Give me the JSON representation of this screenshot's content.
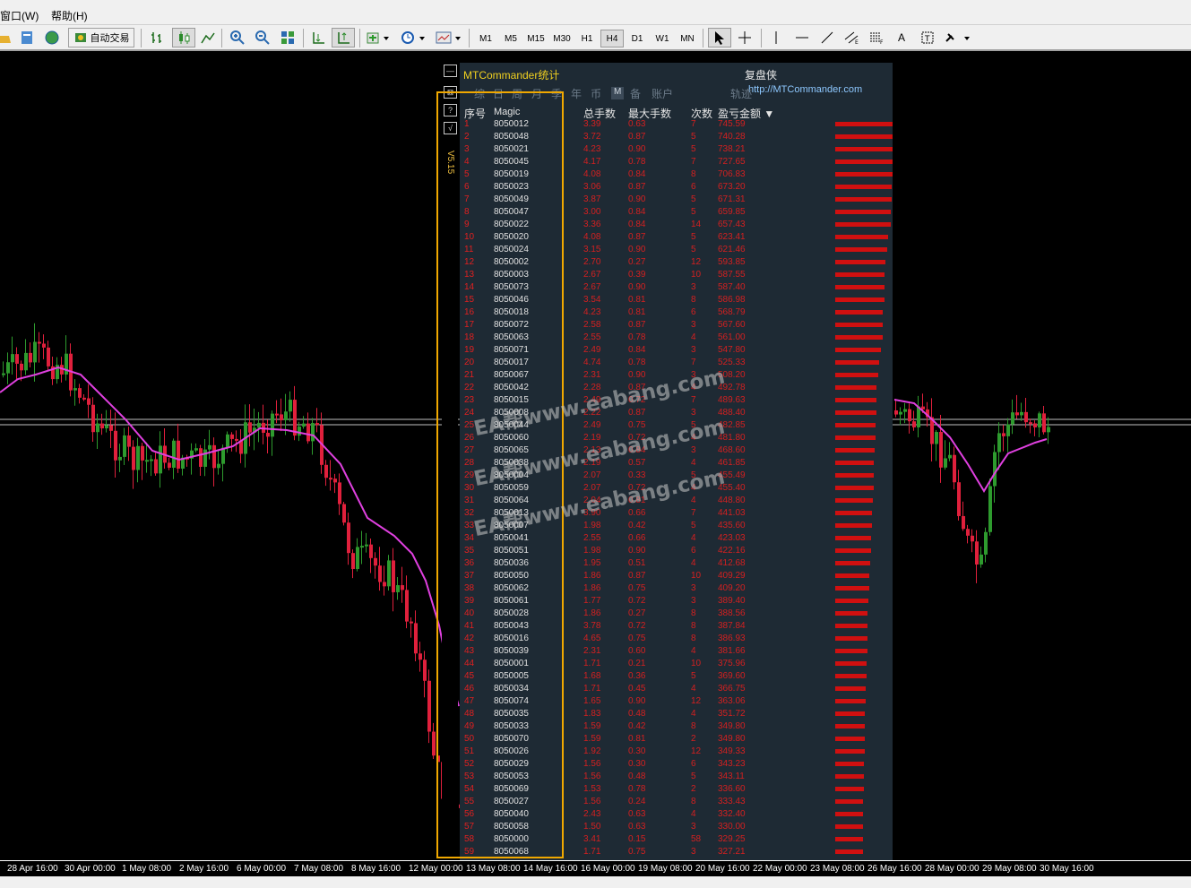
{
  "menu": {
    "window": "窗口(W)",
    "help": "帮助(H)"
  },
  "toolbar": {
    "auto_trade_label": "自动交易",
    "timeframes": [
      "M1",
      "M5",
      "M15",
      "M30",
      "H1",
      "H4",
      "D1",
      "W1",
      "MN"
    ],
    "active_timeframe": "H4",
    "text_tool_label": "A"
  },
  "chart": {
    "time_axis_labels": [
      "28 Apr 16:00",
      "30 Apr 00:00",
      "1 May 08:00",
      "2 May 16:00",
      "6 May 00:00",
      "7 May 08:00",
      "8 May 16:00",
      "12 May 00:00",
      "13 May 08:00",
      "14 May 16:00",
      "16 May 00:00",
      "19 May 08:00",
      "20 May 16:00",
      "22 May 00:00",
      "23 May 08:00",
      "26 May 16:00",
      "28 May 00:00",
      "29 May 08:00",
      "30 May 16:00"
    ],
    "colors": {
      "bull": "#2e9b2e",
      "bear": "#e0203c",
      "ma": "#e040e0",
      "price_line": "#c0c0c0"
    }
  },
  "panel": {
    "title": "MTCommander统计",
    "brand_name": "复盘侠",
    "brand_url": "http://MTCommander.com",
    "version": "V5.15",
    "side_buttons": [
      "—",
      "⊠",
      "?",
      "√"
    ],
    "tabs": [
      "综",
      "日",
      "周",
      "月",
      "季",
      "年",
      "币",
      "M",
      "备",
      "账户",
      "轨迹"
    ],
    "selected_tab": "M",
    "headers": {
      "idx": "序号",
      "magic": "Magic",
      "total_lots": "总手数",
      "max_lots": "最大手数",
      "count": "次数",
      "pnl": "盈亏金额 ▼"
    },
    "rows": [
      [
        "1",
        "8050012",
        "3.39",
        "0.63",
        "7",
        "745.59"
      ],
      [
        "2",
        "8050048",
        "3.72",
        "0.87",
        "5",
        "740.28"
      ],
      [
        "3",
        "8050021",
        "4.23",
        "0.90",
        "5",
        "738.21"
      ],
      [
        "4",
        "8050045",
        "4.17",
        "0.78",
        "7",
        "727.65"
      ],
      [
        "5",
        "8050019",
        "4.08",
        "0.84",
        "8",
        "706.83"
      ],
      [
        "6",
        "8050023",
        "3.06",
        "0.87",
        "6",
        "673.20"
      ],
      [
        "7",
        "8050049",
        "3.87",
        "0.90",
        "5",
        "671.31"
      ],
      [
        "8",
        "8050047",
        "3.00",
        "0.84",
        "5",
        "659.85"
      ],
      [
        "9",
        "8050022",
        "3.36",
        "0.84",
        "14",
        "657.43"
      ],
      [
        "10",
        "8050020",
        "4.08",
        "0.87",
        "5",
        "623.41"
      ],
      [
        "11",
        "8050024",
        "3.15",
        "0.90",
        "5",
        "621.46"
      ],
      [
        "12",
        "8050002",
        "2.70",
        "0.27",
        "12",
        "593.85"
      ],
      [
        "13",
        "8050003",
        "2.67",
        "0.39",
        "10",
        "587.55"
      ],
      [
        "14",
        "8050073",
        "2.67",
        "0.90",
        "3",
        "587.40"
      ],
      [
        "15",
        "8050046",
        "3.54",
        "0.81",
        "8",
        "586.98"
      ],
      [
        "16",
        "8050018",
        "4.23",
        "0.81",
        "6",
        "568.79"
      ],
      [
        "17",
        "8050072",
        "2.58",
        "0.87",
        "3",
        "567.60"
      ],
      [
        "18",
        "8050063",
        "2.55",
        "0.78",
        "4",
        "561.00"
      ],
      [
        "19",
        "8050071",
        "2.49",
        "0.84",
        "3",
        "547.80"
      ],
      [
        "20",
        "8050017",
        "4.74",
        "0.78",
        "7",
        "525.33"
      ],
      [
        "21",
        "8050067",
        "2.31",
        "0.90",
        "3",
        "508.20"
      ],
      [
        "22",
        "8050042",
        "2.28",
        "0.87",
        "4",
        "492.78"
      ],
      [
        "23",
        "8050015",
        "2.49",
        "0.72",
        "7",
        "489.63"
      ],
      [
        "24",
        "8050008",
        "2.22",
        "0.87",
        "3",
        "488.40"
      ],
      [
        "25",
        "8050044",
        "2.49",
        "0.75",
        "5",
        "482.85"
      ],
      [
        "26",
        "8050060",
        "2.19",
        "0.72",
        "4",
        "481.80"
      ],
      [
        "27",
        "8050065",
        "2.13",
        "0.84",
        "3",
        "468.60"
      ],
      [
        "28",
        "8050038",
        "2.19",
        "0.57",
        "4",
        "461.85"
      ],
      [
        "29",
        "8050004",
        "2.07",
        "0.33",
        "5",
        "455.49"
      ],
      [
        "30",
        "8050059",
        "2.07",
        "0.72",
        "4",
        "455.40"
      ],
      [
        "31",
        "8050064",
        "2.04",
        "0.81",
        "4",
        "448.80"
      ],
      [
        "32",
        "8050013",
        "3.90",
        "0.66",
        "7",
        "441.03"
      ],
      [
        "33",
        "8050007",
        "1.98",
        "0.42",
        "5",
        "435.60"
      ],
      [
        "34",
        "8050041",
        "2.55",
        "0.66",
        "4",
        "423.03"
      ],
      [
        "35",
        "8050051",
        "1.98",
        "0.90",
        "6",
        "422.16"
      ],
      [
        "36",
        "8050036",
        "1.95",
        "0.51",
        "4",
        "412.68"
      ],
      [
        "37",
        "8050050",
        "1.86",
        "0.87",
        "10",
        "409.29"
      ],
      [
        "38",
        "8050062",
        "1.86",
        "0.75",
        "3",
        "409.20"
      ],
      [
        "39",
        "8050061",
        "1.77",
        "0.72",
        "3",
        "389.40"
      ],
      [
        "40",
        "8050028",
        "1.86",
        "0.27",
        "8",
        "388.56"
      ],
      [
        "41",
        "8050043",
        "3.78",
        "0.72",
        "8",
        "387.84"
      ],
      [
        "42",
        "8050016",
        "4.65",
        "0.75",
        "8",
        "386.93"
      ],
      [
        "43",
        "8050039",
        "2.31",
        "0.60",
        "4",
        "381.66"
      ],
      [
        "44",
        "8050001",
        "1.71",
        "0.21",
        "10",
        "375.96"
      ],
      [
        "45",
        "8050005",
        "1.68",
        "0.36",
        "5",
        "369.60"
      ],
      [
        "46",
        "8050034",
        "1.71",
        "0.45",
        "4",
        "366.75"
      ],
      [
        "47",
        "8050074",
        "1.65",
        "0.90",
        "12",
        "363.06"
      ],
      [
        "48",
        "8050035",
        "1.83",
        "0.48",
        "4",
        "351.72"
      ],
      [
        "49",
        "8050033",
        "1.59",
        "0.42",
        "8",
        "349.80"
      ],
      [
        "50",
        "8050070",
        "1.59",
        "0.81",
        "2",
        "349.80"
      ],
      [
        "51",
        "8050026",
        "1.92",
        "0.30",
        "12",
        "349.33"
      ],
      [
        "52",
        "8050029",
        "1.56",
        "0.30",
        "6",
        "343.23"
      ],
      [
        "53",
        "8050053",
        "1.56",
        "0.48",
        "5",
        "343.11"
      ],
      [
        "54",
        "8050069",
        "1.53",
        "0.78",
        "2",
        "336.60"
      ],
      [
        "55",
        "8050027",
        "1.56",
        "0.24",
        "8",
        "333.43"
      ],
      [
        "56",
        "8050040",
        "2.43",
        "0.63",
        "4",
        "332.40"
      ],
      [
        "57",
        "8050058",
        "1.50",
        "0.63",
        "3",
        "330.00"
      ],
      [
        "58",
        "8050000",
        "3.41",
        "0.15",
        "58",
        "329.25"
      ],
      [
        "59",
        "8050068",
        "1.71",
        "0.75",
        "3",
        "327.21"
      ]
    ]
  },
  "watermarks": [
    "EA帮www.eabang.com",
    "EA帮www.eabang.com",
    "EA帮www.eabang.com"
  ]
}
